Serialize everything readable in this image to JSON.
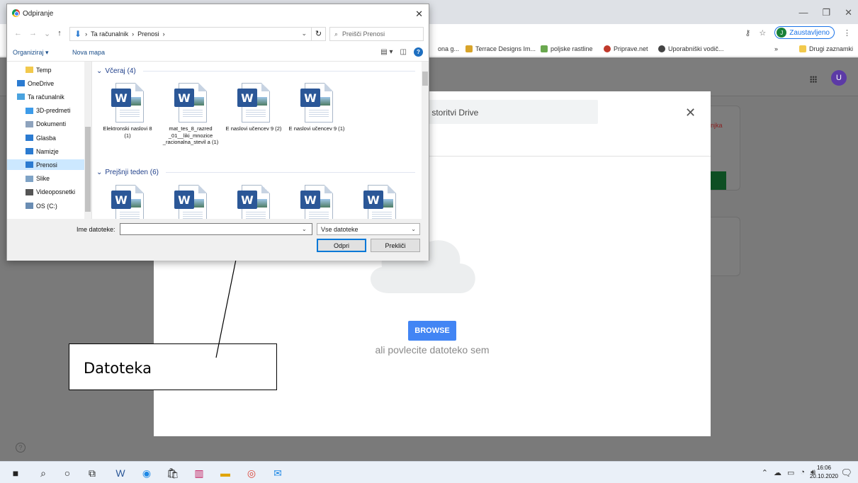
{
  "chrome": {
    "profile_initial": "J",
    "profile_status": "Zaustavljeno",
    "bookmarks": [
      {
        "label": "ona g...",
        "color": "#e3a52b"
      },
      {
        "label": "Terrace Designs Im...",
        "color": "#d8a42a"
      },
      {
        "label": "poljske rastline",
        "color": "#6aa84f"
      },
      {
        "label": "Priprave.net",
        "color": "#c0392b"
      },
      {
        "label": "Uporabniški vodič...",
        "color": "#444444"
      }
    ],
    "bookmarks_more": "»",
    "other_bookmarks": "Drugi zaznamki"
  },
  "drive_page": {
    "user_initial": "U",
    "side_text": "njka"
  },
  "upload_modal": {
    "search_text": "v storitvi Drive",
    "close_glyph": "✕",
    "browse_label": "BROWSE",
    "drag_text": "ali povlecite datoteko sem"
  },
  "annotation": {
    "label": "Datoteka"
  },
  "dialog": {
    "title": "Odpiranje",
    "close_glyph": "✕",
    "breadcrumb": [
      "Ta računalnik",
      "Prenosi"
    ],
    "search_placeholder": "Preišči Prenosi",
    "organize_label": "Organiziraj ▾",
    "new_folder_label": "Nova mapa",
    "nav_items": [
      {
        "label": "Temp",
        "icon": "folder-icon",
        "color": "#f2c94c",
        "child": true,
        "selected": false
      },
      {
        "label": "OneDrive",
        "icon": "cloud-icon",
        "color": "#2b7bd1",
        "child": false,
        "selected": false
      },
      {
        "label": "Ta računalnik",
        "icon": "computer-icon",
        "color": "#4aa3df",
        "child": false,
        "selected": false
      },
      {
        "label": "3D-predmeti",
        "icon": "cube-icon",
        "color": "#3d9be9",
        "child": true,
        "selected": false
      },
      {
        "label": "Dokumenti",
        "icon": "document-icon",
        "color": "#8ea3bd",
        "child": true,
        "selected": false
      },
      {
        "label": "Glasba",
        "icon": "music-icon",
        "color": "#2b7bd1",
        "child": true,
        "selected": false
      },
      {
        "label": "Namizje",
        "icon": "desktop-icon",
        "color": "#2b7bd1",
        "child": true,
        "selected": false
      },
      {
        "label": "Prenosi",
        "icon": "download-icon",
        "color": "#2b7bd1",
        "child": true,
        "selected": true
      },
      {
        "label": "Slike",
        "icon": "picture-icon",
        "color": "#7fa3c6",
        "child": true,
        "selected": false
      },
      {
        "label": "Videoposnetki",
        "icon": "video-icon",
        "color": "#555555",
        "child": true,
        "selected": false
      },
      {
        "label": "OS (C:)",
        "icon": "drive-icon",
        "color": "#6a8db3",
        "child": true,
        "selected": false
      }
    ],
    "groups": [
      {
        "header": "Včeraj (4)"
      },
      {
        "header": "Prejšnji teden (6)"
      }
    ],
    "files_yesterday": [
      {
        "name": "Elektronski naslovi 8 (1)"
      },
      {
        "name": "mat_tes_8_razred _01__liki_mnozice _racionalna_stevil a (1)"
      },
      {
        "name": "E naslovi učencev 9 (2)"
      },
      {
        "name": "E naslovi učencev 9 (1)"
      }
    ],
    "files_last_week_visible": 5,
    "filename_label": "Ime datoteke:",
    "filename_value": "",
    "filetype_value": "Vse datoteke",
    "open_label": "Odpri",
    "cancel_label": "Prekliči"
  },
  "taskbar": {
    "time": "16:06",
    "date": "20.10.2020"
  }
}
